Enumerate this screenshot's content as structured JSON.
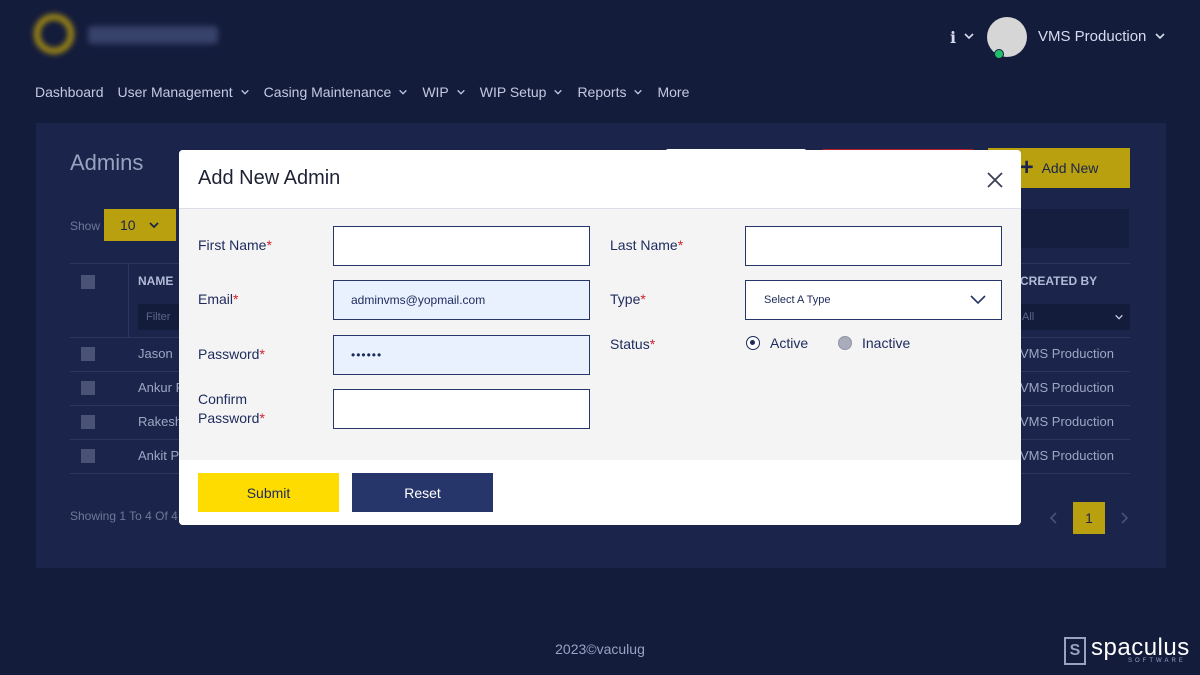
{
  "header": {
    "logo_text": "vaculug",
    "info_icon": "info-icon",
    "user_name": "VMS Production"
  },
  "nav": {
    "items": [
      {
        "label": "Dashboard",
        "has_dropdown": false
      },
      {
        "label": "User Management",
        "has_dropdown": true
      },
      {
        "label": "Casing Maintenance",
        "has_dropdown": true
      },
      {
        "label": "WIP",
        "has_dropdown": true
      },
      {
        "label": "WIP Setup",
        "has_dropdown": true
      },
      {
        "label": "Reports",
        "has_dropdown": true
      },
      {
        "label": "More",
        "has_dropdown": false
      }
    ]
  },
  "page": {
    "title": "Admins",
    "add_new_label": "Add New",
    "show_label": "Show",
    "show_value": "10",
    "table": {
      "col_name": "NAME",
      "col_created_by": "CREATED BY",
      "filter_placeholder": "Filter",
      "created_by_filter": "All",
      "rows": [
        {
          "name": "Jason",
          "created_by": "VMS Production"
        },
        {
          "name": "Ankur P",
          "created_by": "VMS Production"
        },
        {
          "name": "Rakesh",
          "created_by": "VMS Production"
        },
        {
          "name": "Ankit P",
          "created_by": "VMS Production"
        }
      ]
    },
    "showing_text": "Showing 1 To 4 Of 4",
    "current_page": "1"
  },
  "modal": {
    "title": "Add New Admin",
    "fields": {
      "first_name": {
        "label": "First Name",
        "value": ""
      },
      "last_name": {
        "label": "Last Name",
        "value": ""
      },
      "email": {
        "label": "Email",
        "value": "adminvms@yopmail.com"
      },
      "type": {
        "label": "Type",
        "placeholder": "Select A Type"
      },
      "password": {
        "label": "Password",
        "value": "••••••"
      },
      "status": {
        "label": "Status",
        "options": [
          "Active",
          "Inactive"
        ],
        "selected": "Active"
      },
      "confirm_password": {
        "label_line1": "Confirm",
        "label_line2": "Password",
        "value": ""
      }
    },
    "required_marker": "*",
    "submit_label": "Submit",
    "reset_label": "Reset"
  },
  "footer": {
    "copyright": "2023©vaculug",
    "brand_name": "spaculus",
    "brand_sub": "SOFTWARE"
  },
  "colors": {
    "background": "#141c3c",
    "accent_yellow": "#ffdc00",
    "navy": "#27366a",
    "required_red": "#d0202c"
  }
}
